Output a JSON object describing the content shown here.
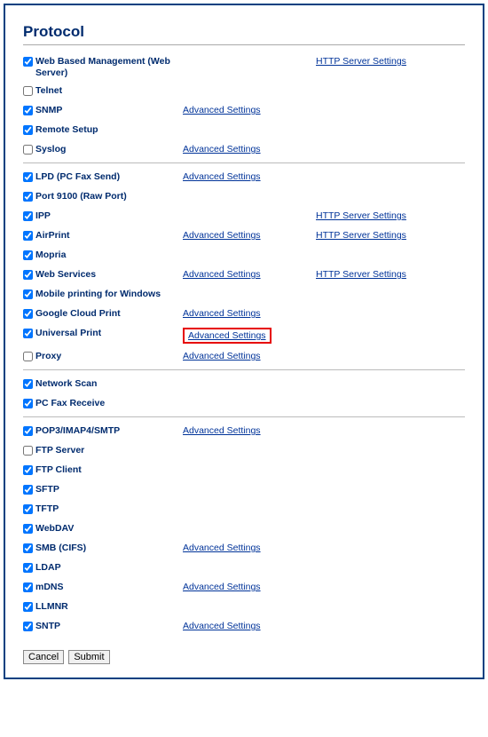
{
  "page_title": "Protocol",
  "advanced_label": "Advanced Settings",
  "http_server_label": "HTTP Server Settings",
  "buttons": {
    "cancel": "Cancel",
    "submit": "Submit"
  },
  "sections": [
    [
      {
        "id": "web-based-mgmt",
        "label": "Web Based Management (Web Server)",
        "checked": true,
        "http": true
      },
      {
        "id": "telnet",
        "label": "Telnet",
        "checked": false
      },
      {
        "id": "snmp",
        "label": "SNMP",
        "checked": true,
        "adv": true
      },
      {
        "id": "remote-setup",
        "label": "Remote Setup",
        "checked": true
      },
      {
        "id": "syslog",
        "label": "Syslog",
        "checked": false,
        "adv": true
      }
    ],
    [
      {
        "id": "lpd",
        "label": "LPD (PC Fax Send)",
        "checked": true,
        "adv": true
      },
      {
        "id": "port9100",
        "label": "Port 9100 (Raw Port)",
        "checked": true
      },
      {
        "id": "ipp",
        "label": "IPP",
        "checked": true,
        "http": true
      },
      {
        "id": "airprint",
        "label": "AirPrint",
        "checked": true,
        "adv": true,
        "http": true
      },
      {
        "id": "mopria",
        "label": "Mopria",
        "checked": true
      },
      {
        "id": "web-services",
        "label": "Web Services",
        "checked": true,
        "adv": true,
        "http": true
      },
      {
        "id": "mobile-printing",
        "label": "Mobile printing for Windows",
        "checked": true
      },
      {
        "id": "google-cloud",
        "label": "Google Cloud Print",
        "checked": true,
        "adv": true
      },
      {
        "id": "universal-print",
        "label": "Universal Print",
        "checked": true,
        "adv": true,
        "highlight": true
      },
      {
        "id": "proxy",
        "label": "Proxy",
        "checked": false,
        "adv": true
      }
    ],
    [
      {
        "id": "network-scan",
        "label": "Network Scan",
        "checked": true
      },
      {
        "id": "pc-fax-receive",
        "label": "PC Fax Receive",
        "checked": true
      }
    ],
    [
      {
        "id": "pop3-imap-smtp",
        "label": "POP3/IMAP4/SMTP",
        "checked": true,
        "adv": true
      },
      {
        "id": "ftp-server",
        "label": "FTP Server",
        "checked": false
      },
      {
        "id": "ftp-client",
        "label": "FTP Client",
        "checked": true
      },
      {
        "id": "sftp",
        "label": "SFTP",
        "checked": true
      },
      {
        "id": "tftp",
        "label": "TFTP",
        "checked": true
      },
      {
        "id": "webdav",
        "label": "WebDAV",
        "checked": true
      },
      {
        "id": "smb-cifs",
        "label": "SMB (CIFS)",
        "checked": true,
        "adv": true
      },
      {
        "id": "ldap",
        "label": "LDAP",
        "checked": true
      },
      {
        "id": "mdns",
        "label": "mDNS",
        "checked": true,
        "adv": true
      },
      {
        "id": "llmnr",
        "label": "LLMNR",
        "checked": true
      },
      {
        "id": "sntp",
        "label": "SNTP",
        "checked": true,
        "adv": true
      }
    ]
  ]
}
